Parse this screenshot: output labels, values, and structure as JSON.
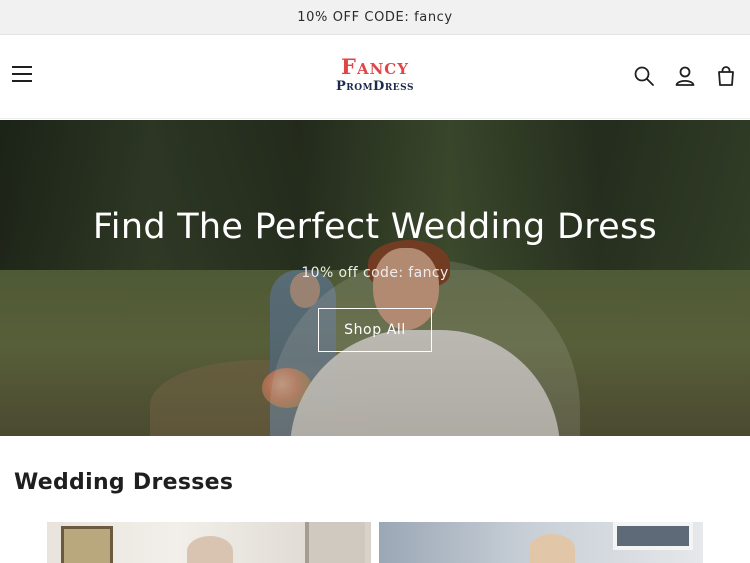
{
  "announcement": {
    "text": "10% OFF CODE: fancy"
  },
  "header": {
    "logo_top": "Fancy",
    "logo_bottom": "PromDress",
    "icons": [
      "menu-icon",
      "search-icon",
      "account-icon",
      "cart-icon"
    ]
  },
  "hero": {
    "title": "Find The Perfect Wedding Dress",
    "subtitle": "10% off code: fancy",
    "button_label": "Shop All"
  },
  "collection": {
    "title": "Wedding Dresses"
  },
  "colors": {
    "logo_accent": "#e04646",
    "logo_dark": "#1c2a4d",
    "announcement_bg": "#f1f1f1",
    "text": "#1f1f1f"
  }
}
